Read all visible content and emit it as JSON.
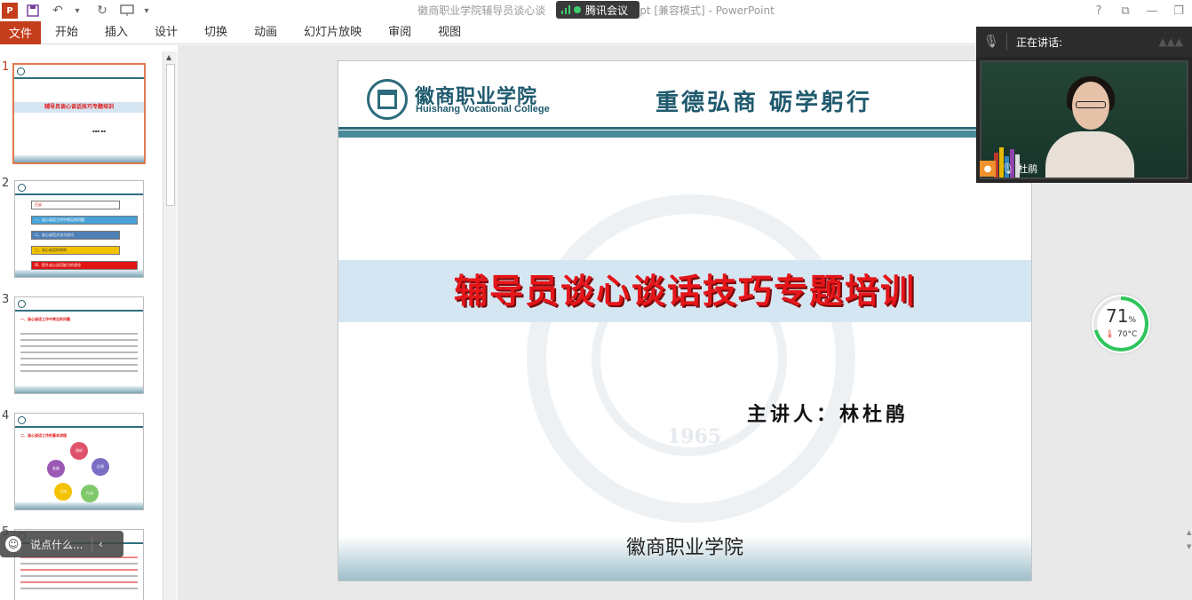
{
  "window": {
    "title": "徽商职业学院辅导员谈心谈话技巧专题培训.ppt [兼容模式] - PowerPoint",
    "title_visible_left": "徽商职业学院辅导员谈心谈",
    "title_visible_right": "pt [兼容模式] - PowerPoint",
    "controls": [
      "?",
      "⧉",
      "—",
      "❐"
    ]
  },
  "meeting_pill": {
    "label": "腾讯会议"
  },
  "ribbon": {
    "file": "文件",
    "tabs": [
      "开始",
      "插入",
      "设计",
      "切换",
      "动画",
      "幻灯片放映",
      "审阅",
      "视图"
    ]
  },
  "thumbnails": {
    "numbers": [
      "1",
      "2",
      "3",
      "4",
      "5"
    ],
    "t1_title": "辅导员谈心谈话技巧专题培训",
    "t2_items": [
      "目录",
      "一、谈心谈话工作中常见的问题",
      "二、谈心谈话方法与技巧",
      "三、谈心谈话的原则",
      "四、提升谈心谈话能力的途径"
    ],
    "t3_title": "一、谈心谈话工作中常见的问题",
    "t4_title": "二、谈心谈话工作的基本流程",
    "t4_circles": [
      "准备",
      "倾听",
      "反馈",
      "认知",
      "行动"
    ]
  },
  "slide": {
    "school_cn": "徽商职业学院",
    "school_en": "Huishang Vocational College",
    "motto": "重德弘商  砺学躬行",
    "title": "辅导员谈心谈话技巧专题培训",
    "speaker": "主讲人：林杜鹃",
    "college_footer": "徽商职业学院",
    "watermark_year": "1965"
  },
  "video": {
    "speaking_label": "正在讲话:",
    "participant": "杜鹃"
  },
  "gauge": {
    "value": 71,
    "unit": "%",
    "temp": "70°C"
  },
  "chat": {
    "placeholder": "说点什么..."
  }
}
